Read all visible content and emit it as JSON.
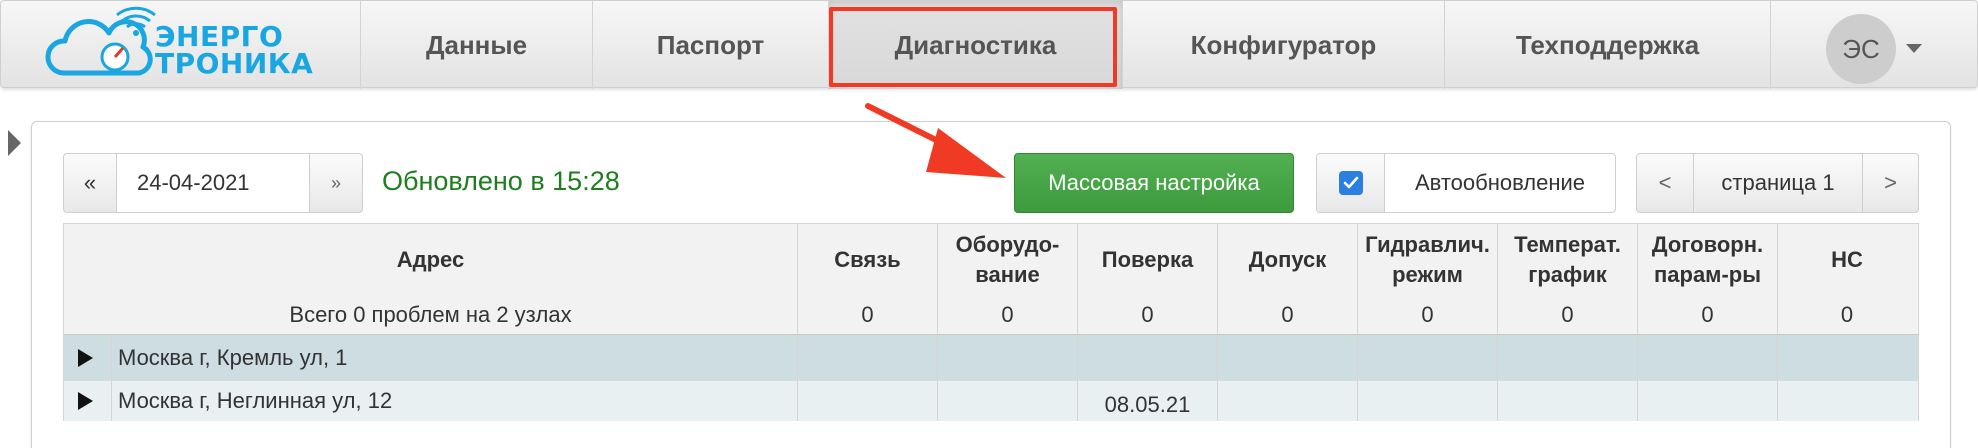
{
  "brand": {
    "line1": "ЭНЕРГО",
    "line2": "ТРОНИКА",
    "color": "#1aa6e0"
  },
  "nav": {
    "items": [
      {
        "label": "Данные"
      },
      {
        "label": "Паспорт"
      },
      {
        "label": "Диагностика",
        "active": true
      },
      {
        "label": "Конфигуратор"
      },
      {
        "label": "Техподдержка"
      }
    ],
    "user_initials": "ЭС"
  },
  "toolbar": {
    "prev_label": "«",
    "date_value": "24-04-2021",
    "next_label": "»",
    "updated_text": "Обновлено в 15:28",
    "mass_button_label": "Массовая настройка",
    "auto_update_label": "Автообновление",
    "auto_update_checked": true,
    "pager": {
      "prev": "<",
      "page_label": "страница 1",
      "next": ">"
    }
  },
  "table": {
    "headers": [
      [
        "Адрес"
      ],
      [
        "Связь"
      ],
      [
        "Оборудо-",
        "вание"
      ],
      [
        "Поверка"
      ],
      [
        "Допуск"
      ],
      [
        "Гидравлич.",
        "режим"
      ],
      [
        "Температ.",
        "график"
      ],
      [
        "Договорн.",
        "парам-ры"
      ],
      [
        "НС"
      ]
    ],
    "summary": {
      "label": "Всего 0 проблем на 2 узлах",
      "values": [
        "0",
        "0",
        "0",
        "0",
        "0",
        "0",
        "0",
        "0"
      ]
    },
    "rows": [
      {
        "address": "Москва г, Кремль ул, 1",
        "cells": [
          "",
          "",
          "",
          "",
          "",
          "",
          "",
          ""
        ]
      },
      {
        "address": "Москва г, Неглинная ул, 12",
        "cells": [
          "",
          "",
          "08.05.21",
          "",
          "",
          "",
          "",
          ""
        ]
      }
    ]
  },
  "colors": {
    "accent_green": "#3d9b3d",
    "highlight_red": "#f03a24",
    "checkbox_blue": "#2b7fe0"
  }
}
